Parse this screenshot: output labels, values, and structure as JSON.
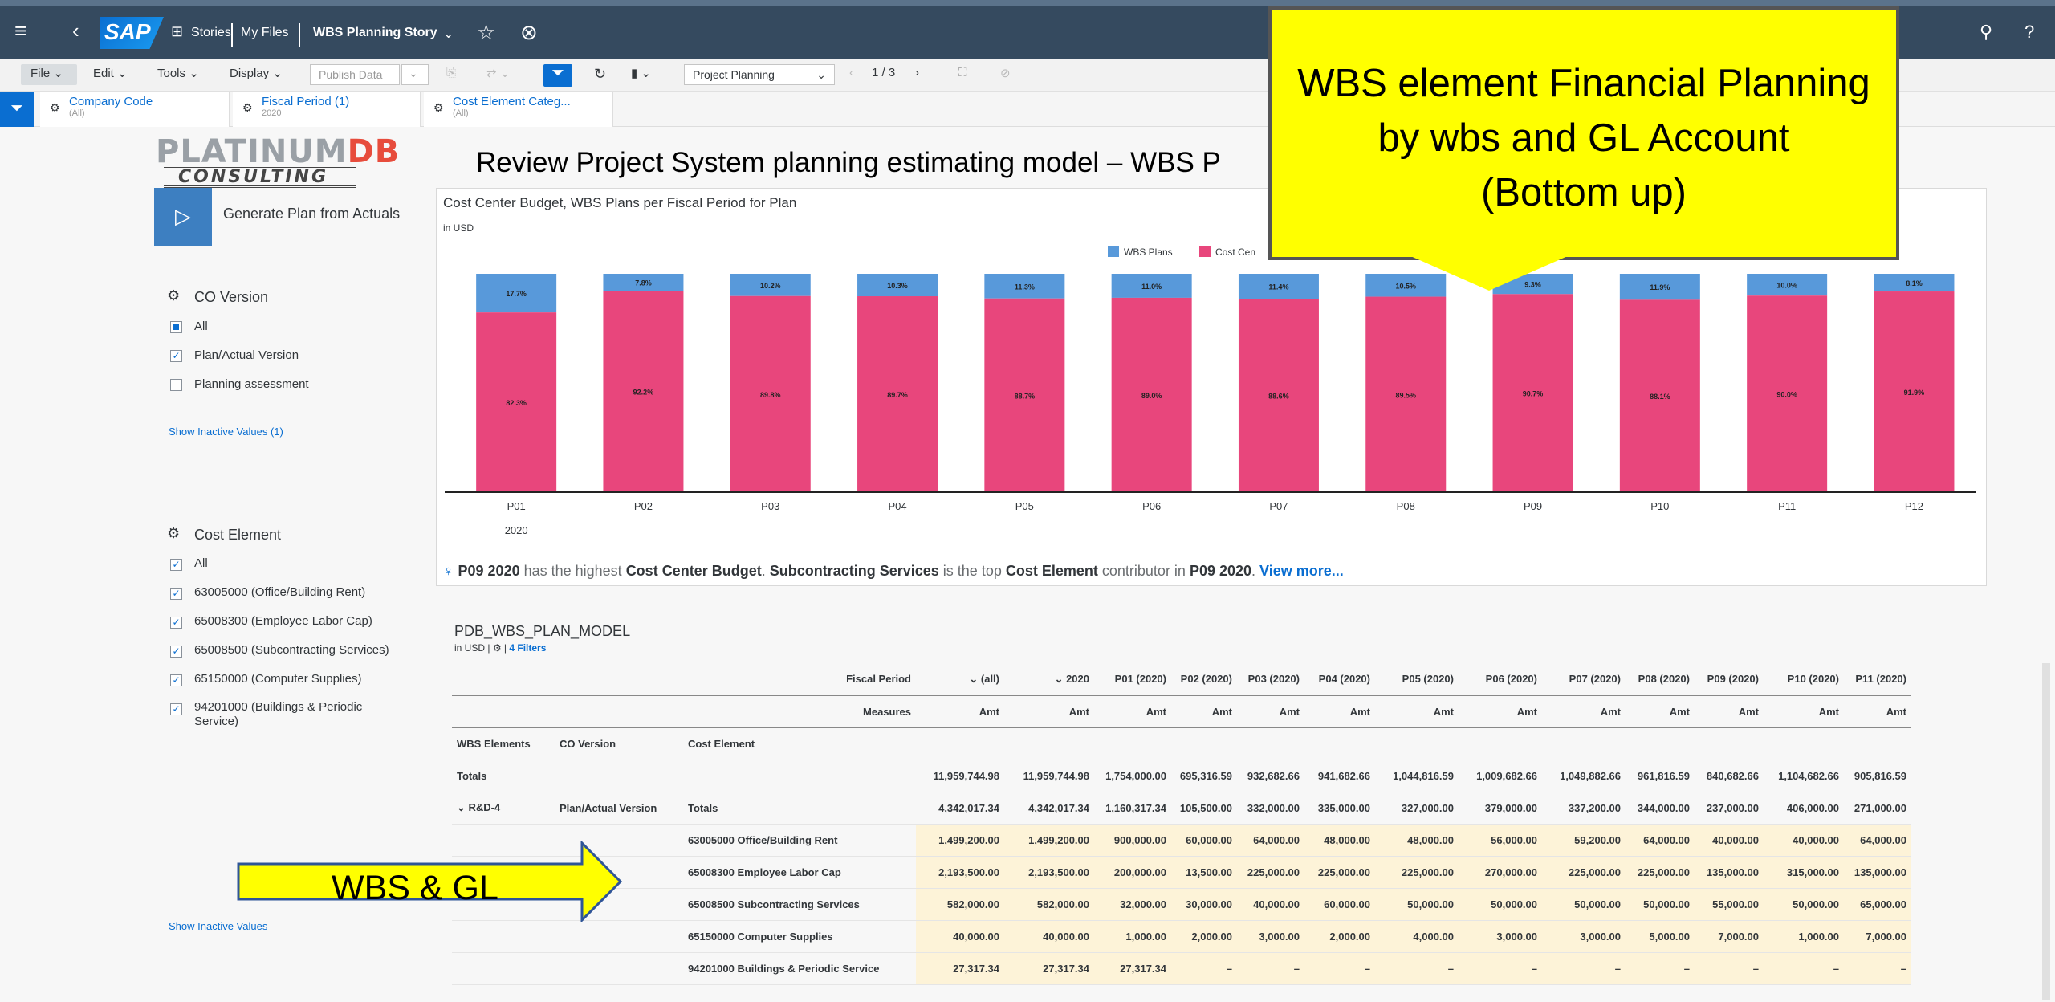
{
  "shell": {
    "app": "SAP",
    "stories_label": "Stories",
    "my_files_label": "My Files",
    "story_title": "WBS Planning Story"
  },
  "toolbar": {
    "file": "File",
    "edit": "Edit",
    "tools": "Tools",
    "display": "Display",
    "publish_data": "Publish Data",
    "page_select": "Project Planning",
    "page_indicator": "1 / 3"
  },
  "filters": [
    {
      "label": "Company Code",
      "value": "(All)"
    },
    {
      "label": "Fiscal Period (1)",
      "value": "2020"
    },
    {
      "label": "Cost Element Categ...",
      "value": "(All)"
    }
  ],
  "logo": {
    "word1": "PLATINUM",
    "word2": "DB",
    "word3": "CONSULTING"
  },
  "left": {
    "generate_label": "Generate Plan from Actuals",
    "co_version": {
      "title": "CO Version",
      "items": [
        {
          "label": "All",
          "state": "partial"
        },
        {
          "label": "Plan/Actual Version",
          "state": "checked"
        },
        {
          "label": "Planning assessment",
          "state": "unchecked"
        }
      ],
      "show_inactive": "Show Inactive Values (1)"
    },
    "cost_element": {
      "title": "Cost Element",
      "items": [
        {
          "label": "All",
          "state": "checked"
        },
        {
          "label": "63005000 (Office/Building Rent)",
          "state": "checked"
        },
        {
          "label": "65008300 (Employee Labor Cap)",
          "state": "checked"
        },
        {
          "label": "65008500 (Subcontracting Services)",
          "state": "checked"
        },
        {
          "label": "65150000 (Computer Supplies)",
          "state": "checked"
        },
        {
          "label": "94201000 (Buildings & Periodic",
          "label2": "Service)",
          "state": "checked"
        }
      ],
      "show_inactive": "Show Inactive Values"
    }
  },
  "page_title": "Review Project System planning estimating model – WBS P",
  "chart": {
    "title": "Cost Center Budget, WBS Plans per Fiscal Period for Plan",
    "unit": "in USD",
    "year_label": "2020",
    "insight": {
      "p1": "P09 2020",
      "t1": " has the highest ",
      "p2": "Cost Center Budget",
      "t2": ". ",
      "p3": "Subcontracting Services",
      "t3": " is the top ",
      "p4": "Cost Element",
      "t4": " contributor in ",
      "p5": "P09 2020",
      "t5": ". ",
      "link": "View more..."
    }
  },
  "chart_data": {
    "type": "bar",
    "stacked": "percent",
    "categories": [
      "P01",
      "P02",
      "P03",
      "P04",
      "P05",
      "P06",
      "P07",
      "P08",
      "P09",
      "P10",
      "P11",
      "P12"
    ],
    "series": [
      {
        "name": "WBS Plans",
        "color": "#5899da",
        "values": [
          17.7,
          7.8,
          10.2,
          10.3,
          11.3,
          11.0,
          11.4,
          10.5,
          9.3,
          11.9,
          10.0,
          8.1
        ]
      },
      {
        "name": "Cost Cen",
        "color": "#e8467c",
        "values": [
          82.3,
          92.2,
          89.8,
          89.7,
          88.7,
          89.0,
          88.6,
          89.5,
          90.7,
          88.1,
          90.0,
          91.9
        ]
      }
    ],
    "legend_position": "top-right"
  },
  "table": {
    "title": "PDB_WBS_PLAN_MODEL",
    "unit": "in USD",
    "filters_label": "4 Filters",
    "fiscal_period_label": "Fiscal Period",
    "measures_label": "Measures",
    "dim_headers": [
      "WBS Elements",
      "CO Version",
      "Cost Element"
    ],
    "columns": [
      "(all)",
      "2020",
      "P01 (2020)",
      "P02 (2020)",
      "P03 (2020)",
      "P04 (2020)",
      "P05 (2020)",
      "P06 (2020)",
      "P07 (2020)",
      "P08 (2020)",
      "P09 (2020)",
      "P10 (2020)",
      "P11 (2020)"
    ],
    "measure": "Amt",
    "totals_label": "Totals",
    "totals": [
      "11,959,744.98",
      "11,959,744.98",
      "1,754,000.00",
      "695,316.59",
      "932,682.66",
      "941,682.66",
      "1,044,816.59",
      "1,009,682.66",
      "1,049,882.66",
      "961,816.59",
      "840,682.66",
      "1,104,682.66",
      "905,816.59"
    ],
    "wbs": "R&D-4",
    "version": "Plan/Actual Version",
    "rows": [
      {
        "label": "Totals",
        "values": [
          "4,342,017.34",
          "4,342,017.34",
          "1,160,317.34",
          "105,500.00",
          "332,000.00",
          "335,000.00",
          "327,000.00",
          "379,000.00",
          "337,200.00",
          "344,000.00",
          "237,000.00",
          "406,000.00",
          "271,000.00"
        ]
      },
      {
        "label": "63005000 Office/Building Rent",
        "values": [
          "1,499,200.00",
          "1,499,200.00",
          "900,000.00",
          "60,000.00",
          "64,000.00",
          "48,000.00",
          "48,000.00",
          "56,000.00",
          "59,200.00",
          "64,000.00",
          "40,000.00",
          "40,000.00",
          "64,000.00"
        ]
      },
      {
        "label": "65008300 Employee Labor Cap",
        "values": [
          "2,193,500.00",
          "2,193,500.00",
          "200,000.00",
          "13,500.00",
          "225,000.00",
          "225,000.00",
          "225,000.00",
          "270,000.00",
          "225,000.00",
          "225,000.00",
          "135,000.00",
          "315,000.00",
          "135,000.00"
        ]
      },
      {
        "label": "65008500 Subcontracting Services",
        "values": [
          "582,000.00",
          "582,000.00",
          "32,000.00",
          "30,000.00",
          "40,000.00",
          "60,000.00",
          "50,000.00",
          "50,000.00",
          "50,000.00",
          "50,000.00",
          "55,000.00",
          "50,000.00",
          "65,000.00"
        ]
      },
      {
        "label": "65150000 Computer Supplies",
        "values": [
          "40,000.00",
          "40,000.00",
          "1,000.00",
          "2,000.00",
          "3,000.00",
          "2,000.00",
          "4,000.00",
          "3,000.00",
          "3,000.00",
          "5,000.00",
          "7,000.00",
          "1,000.00",
          "7,000.00"
        ]
      },
      {
        "label": "94201000 Buildings & Periodic Service",
        "values": [
          "27,317.34",
          "27,317.34",
          "27,317.34",
          "–",
          "–",
          "–",
          "–",
          "–",
          "–",
          "–",
          "–",
          "–",
          "–"
        ]
      }
    ]
  },
  "callout": {
    "line1": "WBS element Financial Planning",
    "line2": "by wbs and GL Account",
    "line3": "(Bottom up)"
  },
  "arrow_label": "WBS & GL"
}
